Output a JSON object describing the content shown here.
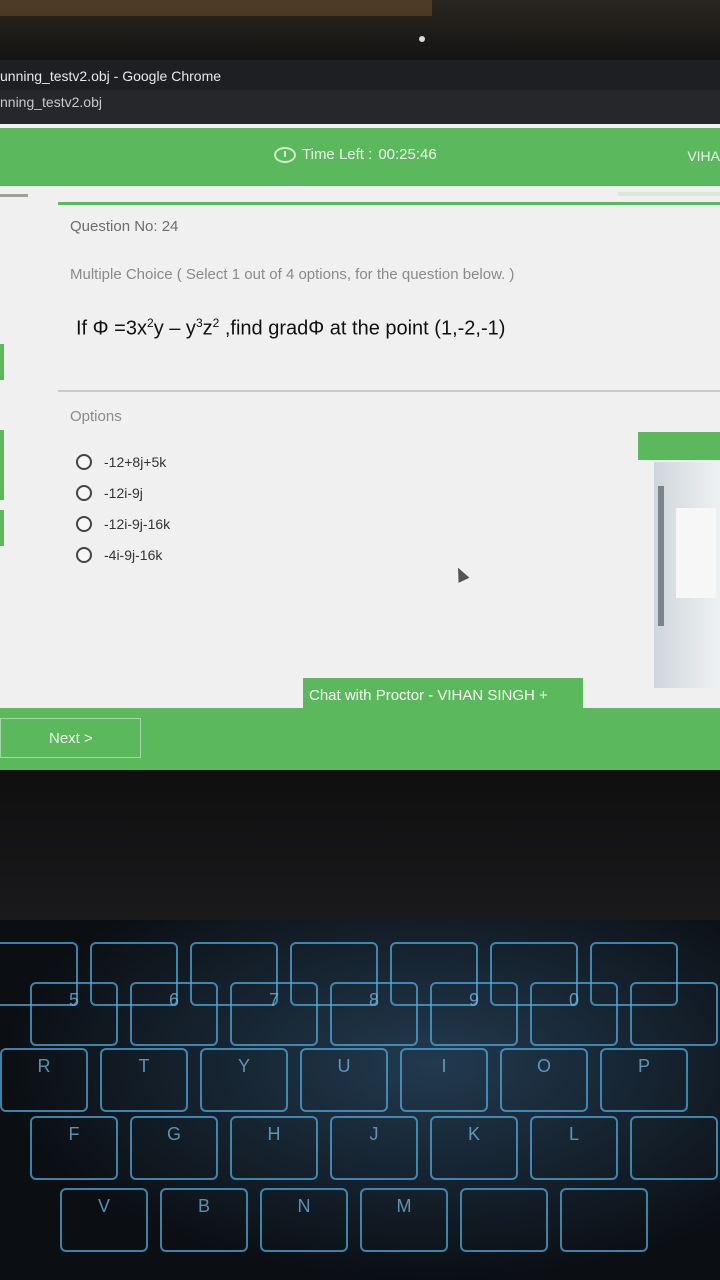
{
  "window": {
    "title": "unning_testv2.obj - Google Chrome",
    "tab": "nning_testv2.obj"
  },
  "header": {
    "time_label": "Time Left :",
    "time_value": "00:25:46",
    "user_short": "VIHA"
  },
  "question": {
    "number_label": "Question No: 24",
    "type_label": "Multiple Choice ( Select 1 out of 4 options, for the question below. )",
    "text_prefix": "If Φ =3x",
    "exp1": "2",
    "text_mid1": "y – y",
    "exp2": "3",
    "text_mid2": "z",
    "exp3": "2",
    "text_suffix": " ,find gradΦ at the point (1,-2,-1)"
  },
  "options": {
    "label": "Options",
    "items": [
      {
        "label": "-12+8j+5k"
      },
      {
        "label": "-12i-9j"
      },
      {
        "label": "-12i-9j-16k"
      },
      {
        "label": "-4i-9j-16k"
      }
    ]
  },
  "chat": {
    "label": "Chat with Proctor - VIHAN SINGH   +"
  },
  "footer": {
    "next_label": "Next >"
  },
  "keyboard": {
    "row1": [
      "",
      "",
      "",
      "",
      "",
      "",
      "",
      ""
    ],
    "row2": [
      "5",
      "6",
      "7",
      "8",
      "9",
      "0",
      "",
      ""
    ],
    "row3": [
      "R",
      "T",
      "Y",
      "U",
      "I",
      "O",
      "P",
      ""
    ],
    "row4": [
      "F",
      "G",
      "H",
      "J",
      "K",
      "L",
      "",
      ""
    ],
    "row5": [
      "V",
      "B",
      "N",
      "M",
      "",
      "",
      "",
      ""
    ]
  },
  "colors": {
    "accent": "#5cb85c",
    "page_bg": "#f0f0f0"
  }
}
